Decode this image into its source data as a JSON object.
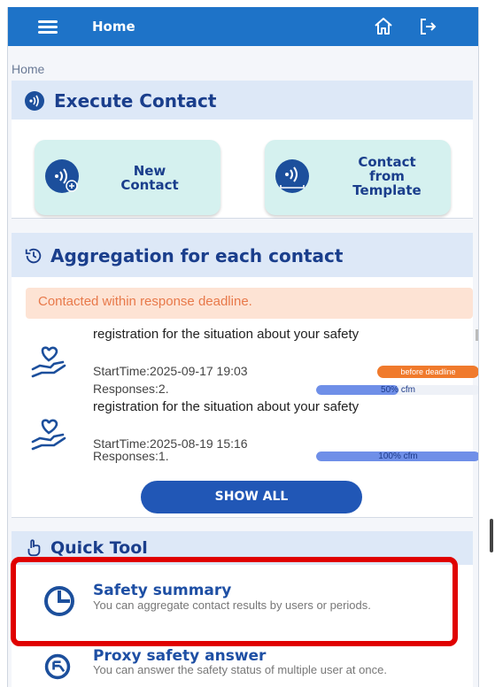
{
  "header": {
    "title": "Home"
  },
  "breadcrumb": "Home",
  "execute_contact": {
    "title": "Execute Contact",
    "buttons": [
      {
        "label_line1": "New",
        "label_line2": "Contact"
      },
      {
        "label_line1": "Contact",
        "label_line2": "from",
        "label_line3": "Template"
      }
    ]
  },
  "aggregation": {
    "title": "Aggregation for each contact",
    "alert": "Contacted within response deadline.",
    "items": [
      {
        "title": "registration for the situation about your safety",
        "start_time": "StartTime:2025-09-17 19:03",
        "responses": "Responses:2.",
        "badge": "before deadline",
        "progress_text": "50% cfm",
        "progress": 0.5
      },
      {
        "title": "registration for the situation about your safety",
        "start_time": "StartTime:2025-08-19 15:16",
        "responses": "Responses:1.",
        "progress_text": "100% cfm",
        "progress": 1.0
      }
    ],
    "show_all": "SHOW ALL"
  },
  "quick_tool": {
    "title": "Quick Tool",
    "tools": [
      {
        "name": "Safety summary",
        "description": "You can aggregate contact results by users or periods."
      },
      {
        "name": "Proxy safety answer",
        "description": "You can answer the safety status of multiple user at once."
      }
    ]
  },
  "colors": {
    "appbar": "#1e73c8",
    "section_header_bg": "#dde8f7",
    "accent_text": "#1a3e8c",
    "contact_button_bg": "#d5f1ef",
    "alert_bg": "#fde3d4",
    "badge": "#f07a2c",
    "show_all": "#2157b6",
    "highlight": "#e00000"
  }
}
